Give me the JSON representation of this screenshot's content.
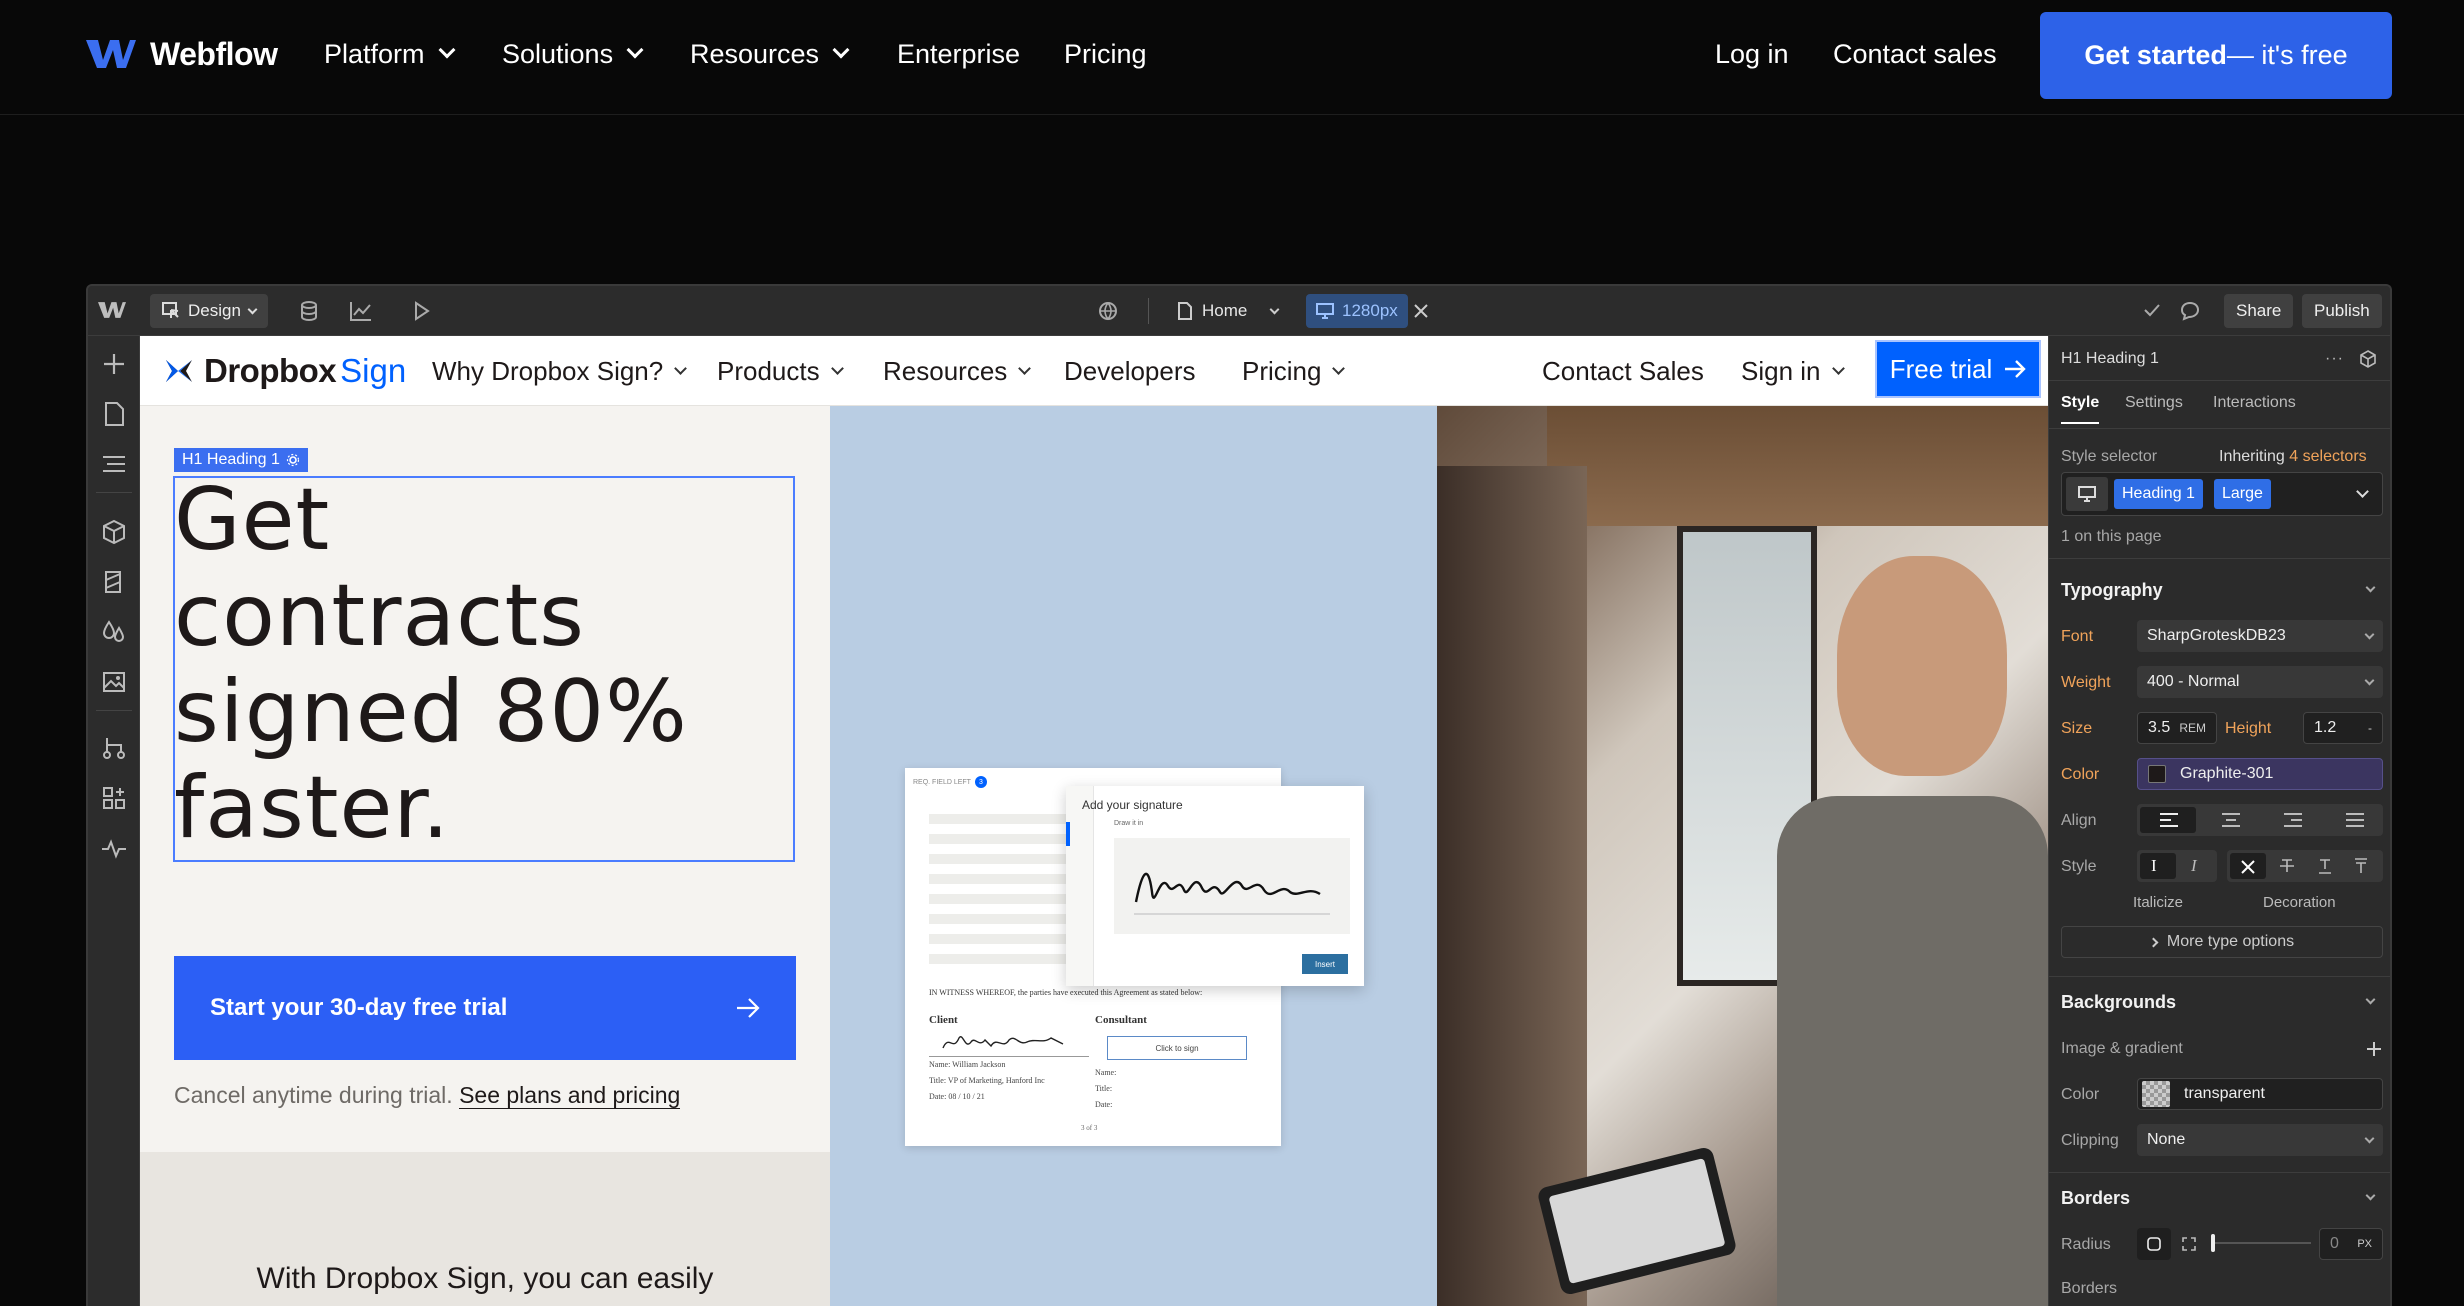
{
  "topnav": {
    "brand": "Webflow",
    "items": [
      {
        "label": "Platform"
      },
      {
        "label": "Solutions"
      },
      {
        "label": "Resources"
      },
      {
        "label": "Enterprise"
      },
      {
        "label": "Pricing"
      }
    ],
    "login": "Log in",
    "contact": "Contact sales",
    "cta_strong": "Get started",
    "cta_rest": " — it's free"
  },
  "editor": {
    "mode": "Design",
    "page": "Home",
    "breakpoint": "1280px",
    "share": "Share",
    "publish": "Publish"
  },
  "site": {
    "logo_bold": "Dropbox",
    "logo_light": "Sign",
    "nav": [
      {
        "label": "Why Dropbox Sign?"
      },
      {
        "label": "Products"
      },
      {
        "label": "Resources"
      },
      {
        "label": "Developers"
      },
      {
        "label": "Pricing"
      }
    ],
    "contact_sales": "Contact Sales",
    "sign_in": "Sign in",
    "free_trial": "Free trial",
    "selected_tag": "H1  Heading 1",
    "headline_lines": [
      "Get",
      "contracts",
      "signed 80%",
      "faster."
    ],
    "start_button": "Start your 30-day free trial",
    "cancel_text": "Cancel anytime during trial.",
    "plans_link": "See plans and pricing",
    "below_text": "With Dropbox Sign, you can easily",
    "doc": {
      "fields_left": "REQ. FIELD LEFT",
      "fields_count": "3",
      "modal_title": "Add your signature",
      "draw_it": "Draw it in",
      "insert": "Insert",
      "witness": "IN WITNESS WHEREOF, the parties have executed this Agreement as stated below:",
      "client": "Client",
      "consultant": "Consultant",
      "click_to_sign": "Click to sign",
      "name_line": "Name: William Jackson",
      "title_line": "Title: VP of Marketing, Hanford Inc",
      "date_line": "Date: 08 / 10 / 21",
      "name_label": "Name:",
      "title_label": "Title:",
      "date_label": "Date:",
      "page_num": "3 of 3"
    }
  },
  "panel": {
    "element": "H1  Heading 1",
    "tabs": [
      "Style",
      "Settings",
      "Interactions"
    ],
    "style_selector": "Style selector",
    "inheriting": "Inheriting",
    "selectors_count": "4 selectors",
    "chip1": "Heading 1",
    "chip2": "Large",
    "on_page": "1 on this page",
    "typography": "Typography",
    "font_label": "Font",
    "font_value": "SharpGroteskDB23",
    "weight_label": "Weight",
    "weight_value": "400 - Normal",
    "size_label": "Size",
    "size_value": "3.5",
    "size_unit": "REM",
    "height_label": "Height",
    "height_value": "1.2",
    "height_unit": "-",
    "color_label": "Color",
    "color_value": "Graphite-301",
    "align_label": "Align",
    "style_label": "Style",
    "italicize": "Italicize",
    "decoration": "Decoration",
    "more_type": "More type options",
    "backgrounds": "Backgrounds",
    "image_gradient": "Image & gradient",
    "bg_color_label": "Color",
    "bg_color_value": "transparent",
    "clipping_label": "Clipping",
    "clipping_value": "None",
    "borders": "Borders",
    "radius_label": "Radius",
    "radius_value": "0",
    "radius_unit": "PX",
    "borders_sub": "Borders"
  },
  "colors": {
    "webflow_blue": "#2d62e8",
    "dropbox_blue": "#0061fe",
    "selection": "#4a7cff",
    "panel_bg": "#2b2b2b",
    "accent_orange": "#f0a35a"
  }
}
